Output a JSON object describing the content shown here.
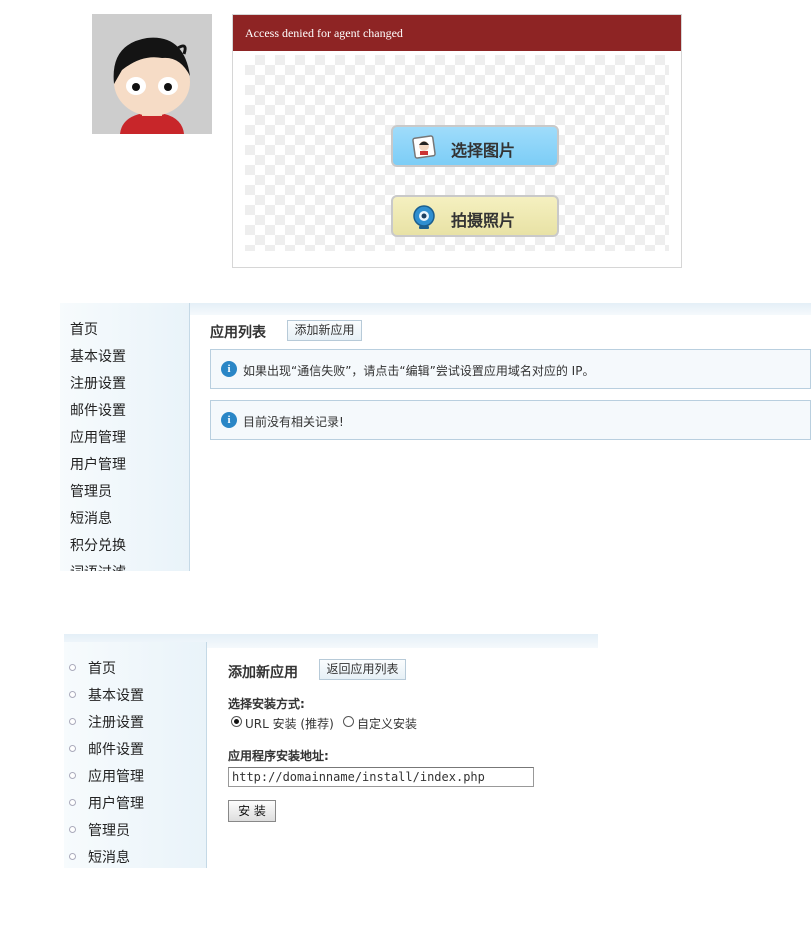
{
  "upload_widget": {
    "header_text": "Access denied for agent changed",
    "select_image_label": "选择图片",
    "take_photo_label": "拍摄照片"
  },
  "app_list_panel": {
    "nav_items": [
      "首页",
      "基本设置",
      "注册设置",
      "邮件设置",
      "应用管理",
      "用户管理",
      "管理员",
      "短消息",
      "积分兑换",
      "词语过滤"
    ],
    "title": "应用列表",
    "add_button_label": "添加新应用",
    "notice_text": "如果出现“通信失败”，请点击“编辑”尝试设置应用域名对应的 IP。",
    "empty_text": "目前没有相关记录!"
  },
  "add_app_panel": {
    "nav_items": [
      "首页",
      "基本设置",
      "注册设置",
      "邮件设置",
      "应用管理",
      "用户管理",
      "管理员",
      "短消息"
    ],
    "title": "添加新应用",
    "back_button_label": "返回应用列表",
    "install_method_label": "选择安装方式:",
    "radio_url_label": "URL 安装 (推荐)",
    "radio_custom_label": "自定义安装",
    "install_url_label": "应用程序安装地址:",
    "install_url_value": "http://domainname/install/index.php",
    "install_button_label": "安 装"
  },
  "colors": {
    "header_red": "#8e2424",
    "select_button": "#8fd5fa",
    "camera_button": "#efe9b4",
    "info_icon": "#2a86c6"
  }
}
